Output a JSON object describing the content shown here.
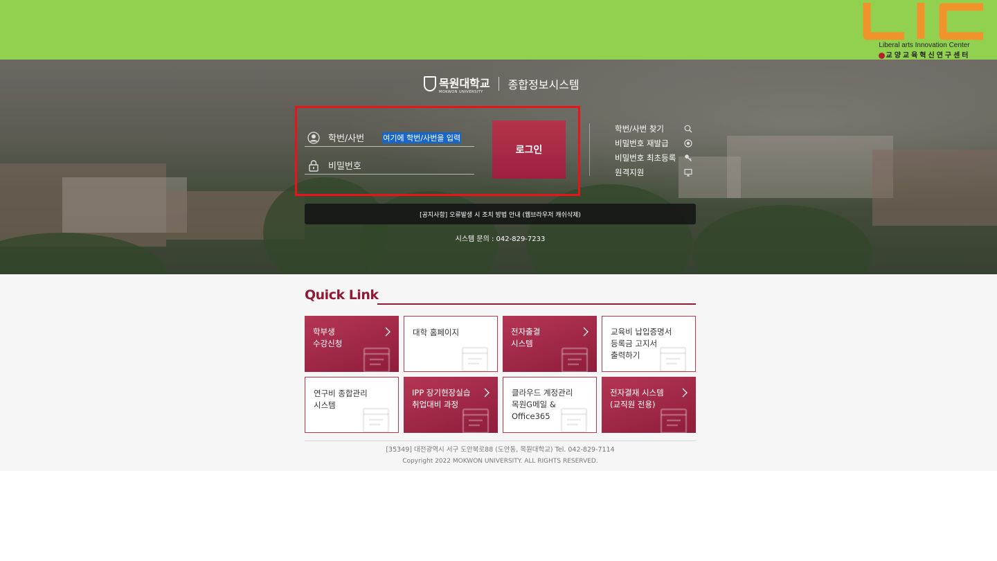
{
  "banner": {
    "logo_text": "LIC",
    "logo_subtitle": "Liberal arts Innovation Center",
    "logo_korean": "교양교육혁신연구센터",
    "logo_color": "#f0932b",
    "background": "#92d14f"
  },
  "brand": {
    "university_name": "목원대학교",
    "university_english": "MOKWON UNIVERSITY",
    "system_name": "종합정보시스템"
  },
  "login": {
    "id_label": "학번/사번",
    "id_value": "여기에 학번/사번을 입력",
    "pw_label": "비밀번호",
    "login_button": "로그인",
    "highlight_color": "#e8141c"
  },
  "side_links": [
    {
      "label": "학번/사번 찾기",
      "icon": "search-icon"
    },
    {
      "label": "비밀번호 재발급",
      "icon": "refresh-icon"
    },
    {
      "label": "비밀번호 최초등록",
      "icon": "key-icon"
    },
    {
      "label": "원격지원",
      "icon": "monitor-icon"
    }
  ],
  "notice": "[공지사항]  오류발생 시 조치 방법 안내 (웹브라우저 캐쉬삭제)",
  "system_contact": "시스템 문의 : 042-829-7233",
  "quick_link": {
    "title": "Quick Link",
    "accent": "#8f1a35",
    "cards": [
      {
        "lines": [
          "학부생",
          "수강신청"
        ],
        "style": "red",
        "chevron": true
      },
      {
        "lines": [
          "대학 홈페이지"
        ],
        "style": "white",
        "chevron": false
      },
      {
        "lines": [
          "전자출결",
          "시스템"
        ],
        "style": "red",
        "chevron": true
      },
      {
        "lines": [
          "교육비 납입증명서",
          "등록금 고지서",
          "출력하기"
        ],
        "style": "white",
        "chevron": false
      },
      {
        "lines": [
          "연구비 종합관리",
          "시스템"
        ],
        "style": "white",
        "chevron": false
      },
      {
        "lines": [
          "IPP 장기현장실습",
          "취업대비 과정"
        ],
        "style": "red",
        "chevron": true
      },
      {
        "lines": [
          "클라우드 계정관리",
          "목원G메일 &",
          "Office365"
        ],
        "style": "white",
        "chevron": false
      },
      {
        "lines": [
          "전자결재 시스템",
          "(교직원 전용)"
        ],
        "style": "red",
        "chevron": true
      }
    ]
  },
  "footer": {
    "address": "[35349] 대전광역시 서구 도안북로88 (도안동, 목원대학교) Tel. 042-829-7114",
    "copyright": "Copyright 2022 MOKWON UNIVERSITY. ALL RIGHTS RESERVED."
  }
}
